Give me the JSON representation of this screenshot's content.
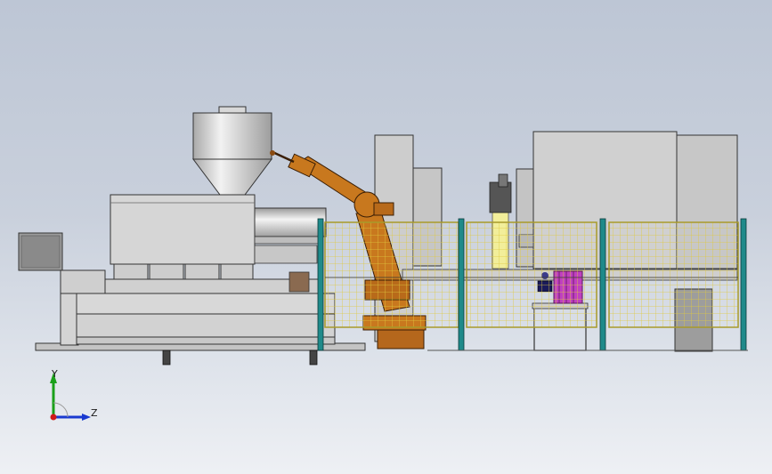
{
  "viewport": {
    "background_top": "#bdc6d5",
    "background_bottom": "#eef0f4"
  },
  "model": {
    "components": [
      "injection-molding-machine",
      "material-hopper",
      "industrial-robot-arm",
      "safety-fence",
      "parts-fixture",
      "control-cabinets"
    ],
    "colors": {
      "machine": "#cfcfcf",
      "robot": "#c8781e",
      "fence_post": "#1f8a8a",
      "fence_mesh": "#e8d34a",
      "fixture": "#c040c0"
    }
  },
  "triad": {
    "y_label": "Y",
    "z_label": "Z",
    "colors": {
      "y": "#1aa01a",
      "z": "#1a3ad0",
      "origin": "#d01a1a"
    }
  }
}
